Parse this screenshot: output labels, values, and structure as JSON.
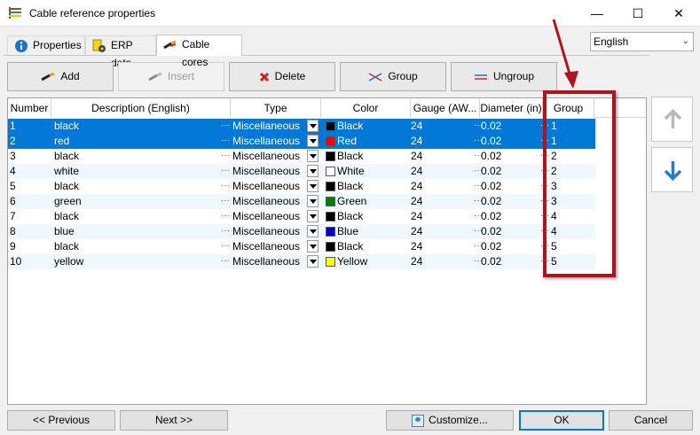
{
  "window": {
    "title": "Cable reference properties",
    "minimize": "—",
    "maximize": "☐",
    "close": "✕"
  },
  "tabs": [
    {
      "label": "Properties",
      "icon": "info-icon"
    },
    {
      "label": "ERP data",
      "icon": "erp-gear-icon"
    },
    {
      "label": "Cable cores",
      "icon": "cable-core-icon",
      "active": true
    }
  ],
  "language": {
    "selected": "English"
  },
  "toolbar": {
    "add": "Add",
    "insert": "Insert",
    "delete": "Delete",
    "group": "Group",
    "ungroup": "Ungroup"
  },
  "grid": {
    "columns": [
      "Number",
      "Description (English)",
      "Type",
      "Color",
      "Gauge (AW...",
      "Diameter (in)",
      "Group"
    ],
    "rows": [
      {
        "number": "1",
        "description": "black",
        "type": "Miscellaneous",
        "color": "Black",
        "hex": "#000000",
        "gauge": "24",
        "diameter": "0.02",
        "group": "1",
        "selected": true
      },
      {
        "number": "2",
        "description": "red",
        "type": "Miscellaneous",
        "color": "Red",
        "hex": "#ff0000",
        "gauge": "24",
        "diameter": "0.02",
        "group": "1",
        "selected": true
      },
      {
        "number": "3",
        "description": "black",
        "type": "Miscellaneous",
        "color": "Black",
        "hex": "#000000",
        "gauge": "24",
        "diameter": "0.02",
        "group": "2",
        "selected": false
      },
      {
        "number": "4",
        "description": "white",
        "type": "Miscellaneous",
        "color": "White",
        "hex": "#ffffff",
        "gauge": "24",
        "diameter": "0.02",
        "group": "2",
        "selected": false
      },
      {
        "number": "5",
        "description": "black",
        "type": "Miscellaneous",
        "color": "Black",
        "hex": "#000000",
        "gauge": "24",
        "diameter": "0.02",
        "group": "3",
        "selected": false
      },
      {
        "number": "6",
        "description": "green",
        "type": "Miscellaneous",
        "color": "Green",
        "hex": "#008000",
        "gauge": "24",
        "diameter": "0.02",
        "group": "3",
        "selected": false
      },
      {
        "number": "7",
        "description": "black",
        "type": "Miscellaneous",
        "color": "Black",
        "hex": "#000000",
        "gauge": "24",
        "diameter": "0.02",
        "group": "4",
        "selected": false
      },
      {
        "number": "8",
        "description": "blue",
        "type": "Miscellaneous",
        "color": "Blue",
        "hex": "#0000cc",
        "gauge": "24",
        "diameter": "0.02",
        "group": "4",
        "selected": false
      },
      {
        "number": "9",
        "description": "black",
        "type": "Miscellaneous",
        "color": "Black",
        "hex": "#000000",
        "gauge": "24",
        "diameter": "0.02",
        "group": "5",
        "selected": false
      },
      {
        "number": "10",
        "description": "yellow",
        "type": "Miscellaneous",
        "color": "Yellow",
        "hex": "#ffff00",
        "gauge": "24",
        "diameter": "0.02",
        "group": "5",
        "selected": false
      }
    ]
  },
  "side_buttons": {
    "up": "arrow-up-icon",
    "down": "arrow-down-icon"
  },
  "footer": {
    "previous": "<< Previous",
    "next": "Next >>",
    "customize": "Customize...",
    "ok": "OK",
    "cancel": "Cancel"
  },
  "colors": {
    "selection": "#0078d7",
    "highlight": "#b0131d",
    "alt_row": "#f0f8ff"
  }
}
